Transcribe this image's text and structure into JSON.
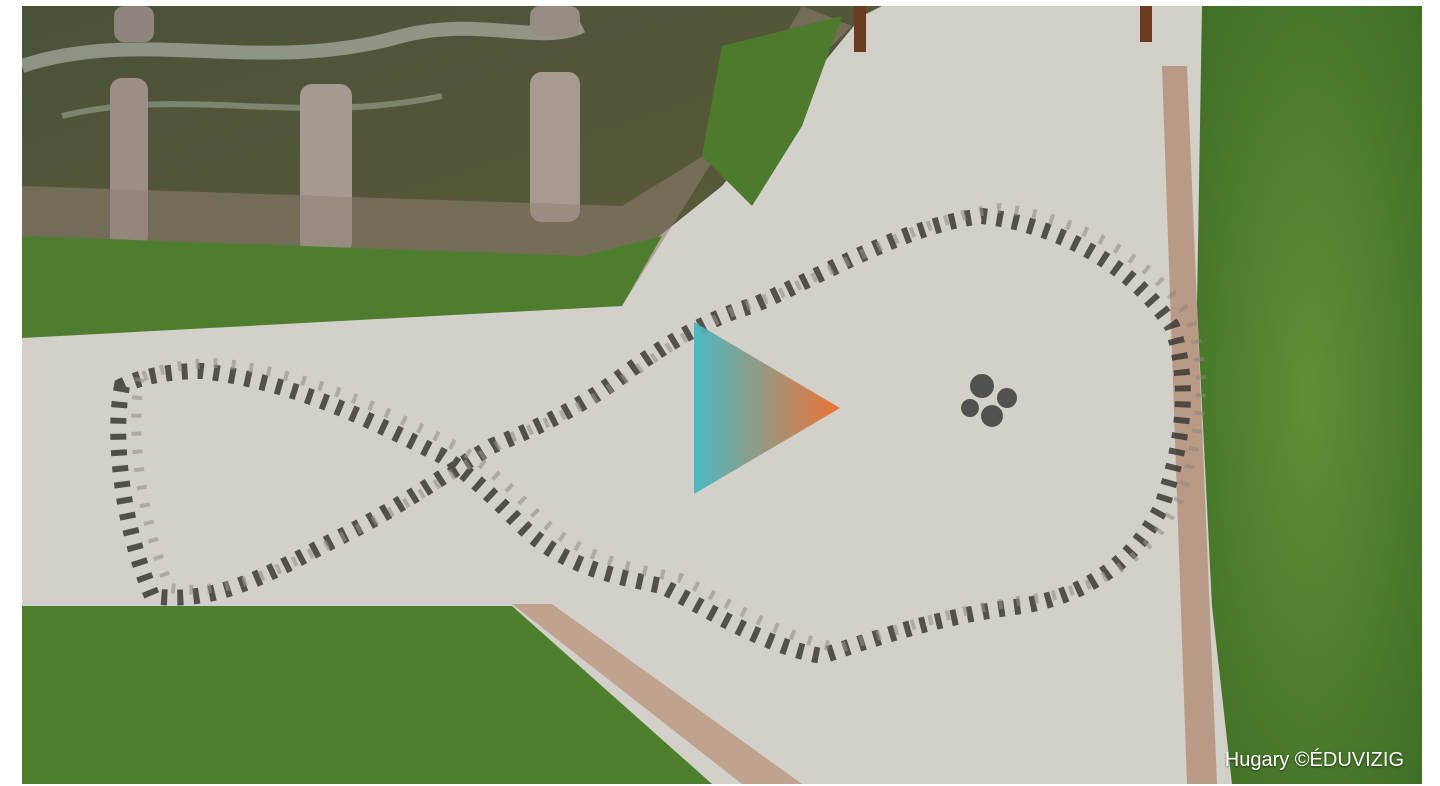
{
  "media": {
    "credit": "Hugary ©ÉDUVIZIG",
    "play_icon": "play-triangle-icon",
    "play_gradient": [
      "#3fb8c4",
      "#f06a28"
    ]
  }
}
